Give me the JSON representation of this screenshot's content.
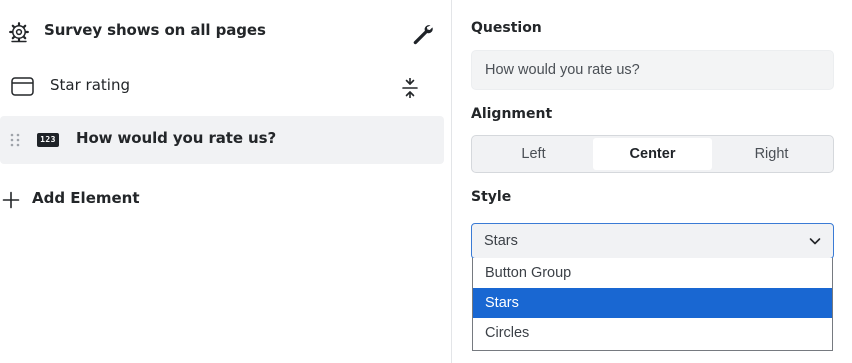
{
  "left_panel": {
    "survey_row": {
      "label": "Survey shows on all pages",
      "icon": "gear-icon",
      "action_icon": "wrench-icon"
    },
    "rating_row": {
      "label": "Star rating",
      "icon": "card-icon",
      "action_icon": "collapse-icon"
    },
    "element_row": {
      "label": "How would you rate us?",
      "icon": "number-rating-icon",
      "icon_text": "123",
      "drag_icon": "drag-handle-icon"
    },
    "add_element": {
      "label": "Add Element",
      "icon": "plus-icon"
    }
  },
  "right_panel": {
    "question": {
      "label": "Question",
      "value": "How would you rate us?"
    },
    "alignment": {
      "label": "Alignment",
      "options": [
        "Left",
        "Center",
        "Right"
      ],
      "selected": "Center"
    },
    "style": {
      "label": "Style",
      "selected": "Stars",
      "options": [
        "Button Group",
        "Stars",
        "Circles"
      ],
      "highlighted_option": "Stars"
    }
  },
  "colors": {
    "selected_row_bg": "#f1f2f4",
    "accent_focus": "#3a7bd5",
    "option_highlight": "#1967d2"
  }
}
